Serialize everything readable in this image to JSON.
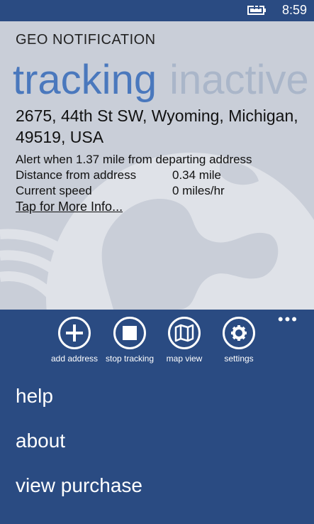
{
  "status": {
    "time": "8:59"
  },
  "app": {
    "title": "GEO NOTIFICATION"
  },
  "pivot": {
    "active": "tracking",
    "inactive": "inactive"
  },
  "address": "2675, 44th St SW, Wyoming, Michigan, 49519, USA",
  "alert_text": "Alert when 1.37 mile from departing address",
  "distance": {
    "label": "Distance from address",
    "value": "0.34 mile"
  },
  "speed": {
    "label": "Current speed",
    "value": "0 miles/hr"
  },
  "more_info": "Tap for More Info...",
  "appbar": {
    "more": "•••",
    "buttons": [
      {
        "label": "add address",
        "icon": "add-icon"
      },
      {
        "label": "stop tracking",
        "icon": "stop-icon"
      },
      {
        "label": "map view",
        "icon": "map-icon"
      },
      {
        "label": "settings",
        "icon": "gear-icon"
      }
    ]
  },
  "menu": [
    "help",
    "about",
    "view purchase"
  ],
  "colors": {
    "accent": "#4a78bd",
    "appbar": "#2a4b82",
    "background": "#c9ced8"
  }
}
